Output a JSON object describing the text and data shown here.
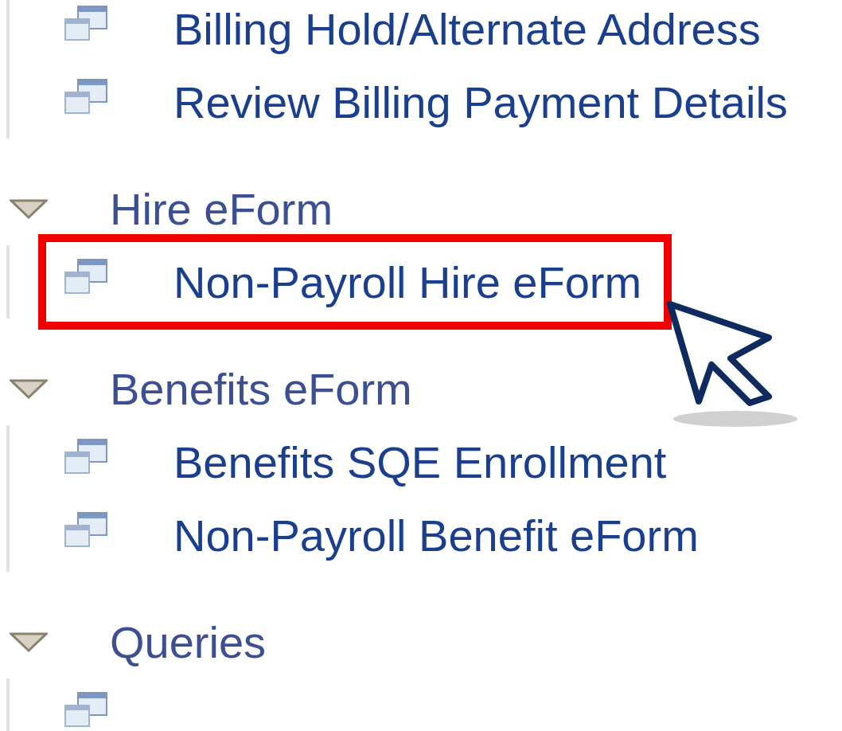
{
  "groups": [
    {
      "items": [
        {
          "label": "Billing Hold/Alternate Address",
          "highlighted": false
        },
        {
          "label": "Review Billing Payment Details",
          "highlighted": false
        }
      ]
    },
    {
      "label": "Hire eForm",
      "expanded": true,
      "items": [
        {
          "label": "Non-Payroll Hire eForm",
          "highlighted": true
        }
      ]
    },
    {
      "label": "Benefits eForm",
      "expanded": true,
      "items": [
        {
          "label": "Benefits SQE Enrollment",
          "highlighted": false
        },
        {
          "label": "Non-Payroll Benefit eForm",
          "highlighted": false
        }
      ]
    },
    {
      "label": "Queries",
      "expanded": true,
      "items": [
        {
          "highlighted": false
        }
      ]
    }
  ]
}
